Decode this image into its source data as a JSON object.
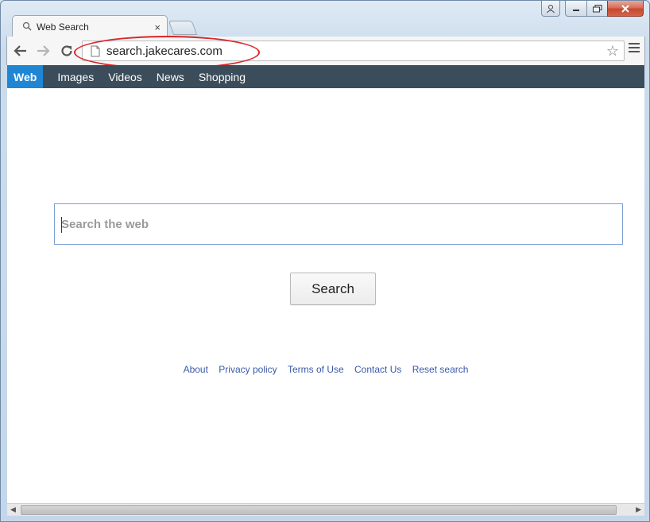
{
  "window": {
    "controls": {
      "user_icon": "user-icon",
      "minimize": "minimize-icon",
      "maximize": "maximize-icon",
      "close": "close-icon"
    }
  },
  "tab": {
    "title": "Web Search",
    "close_label": "×"
  },
  "toolbar": {
    "url": "search.jakecares.com"
  },
  "navbar": {
    "items": [
      {
        "label": "Web",
        "active": true
      },
      {
        "label": "Images"
      },
      {
        "label": "Videos"
      },
      {
        "label": "News"
      },
      {
        "label": "Shopping"
      }
    ]
  },
  "search": {
    "placeholder": "Search the web",
    "value": "",
    "button_label": "Search"
  },
  "footer": {
    "links": [
      "About",
      "Privacy policy",
      "Terms of Use",
      "Contact Us",
      "Reset search"
    ]
  },
  "colors": {
    "navbar_bg": "#3b4d5b",
    "active_tab": "#1f86d4",
    "link": "#3b5aa8",
    "highlight_ellipse": "#d9262a"
  }
}
